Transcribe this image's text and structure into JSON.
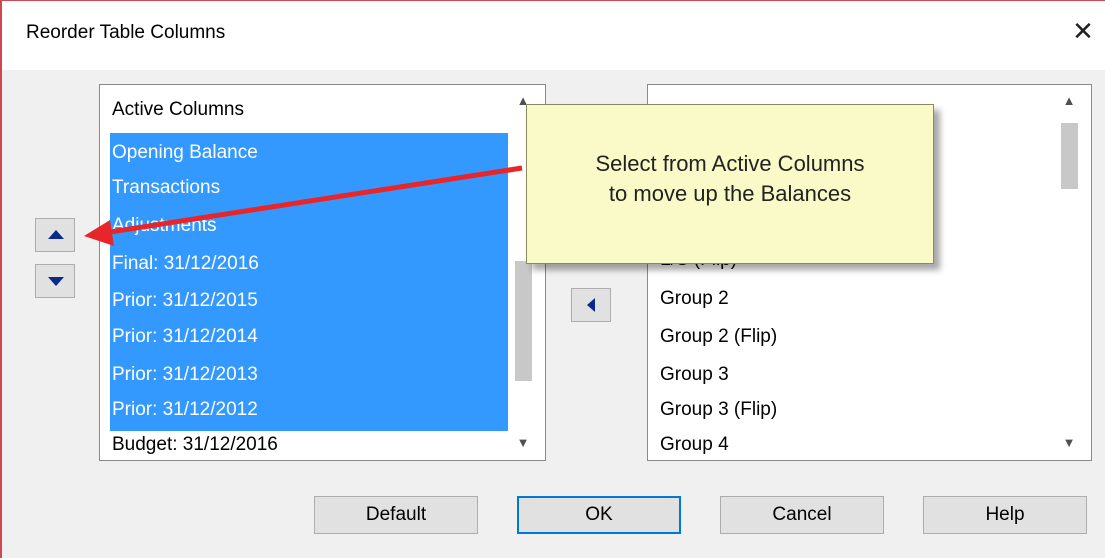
{
  "dialog": {
    "title": "Reorder Table Columns",
    "close_glyph": "✕"
  },
  "left_list": {
    "header": "Active Columns",
    "items": [
      {
        "label": "Opening Balance",
        "selected": true
      },
      {
        "label": "Transactions",
        "selected": true
      },
      {
        "label": "Adjustments",
        "selected": true
      },
      {
        "label": "Final: 31/12/2016",
        "selected": true
      },
      {
        "label": "Prior: 31/12/2015",
        "selected": true
      },
      {
        "label": "Prior: 31/12/2014",
        "selected": true
      },
      {
        "label": "Prior: 31/12/2013",
        "selected": true
      },
      {
        "label": "Prior: 31/12/2012",
        "selected": true
      },
      {
        "label": "Budget: 31/12/2016",
        "selected": false
      }
    ]
  },
  "right_list": {
    "items": [
      "L/S (Flip)",
      "Group 2",
      "Group 2 (Flip)",
      "Group 3",
      "Group 3 (Flip)",
      "Group 4"
    ]
  },
  "scroll_icons": {
    "up": "▲",
    "down": "▼"
  },
  "buttons": {
    "default": "Default",
    "ok": "OK",
    "cancel": "Cancel",
    "help": "Help"
  },
  "callout": {
    "line1": "Select from Active Columns",
    "line2": "to move up the Balances"
  },
  "colors": {
    "selection": "#3399ff",
    "callout_bg": "#fafac8",
    "arrow": "#e8262a",
    "accent": "#0078d7"
  }
}
